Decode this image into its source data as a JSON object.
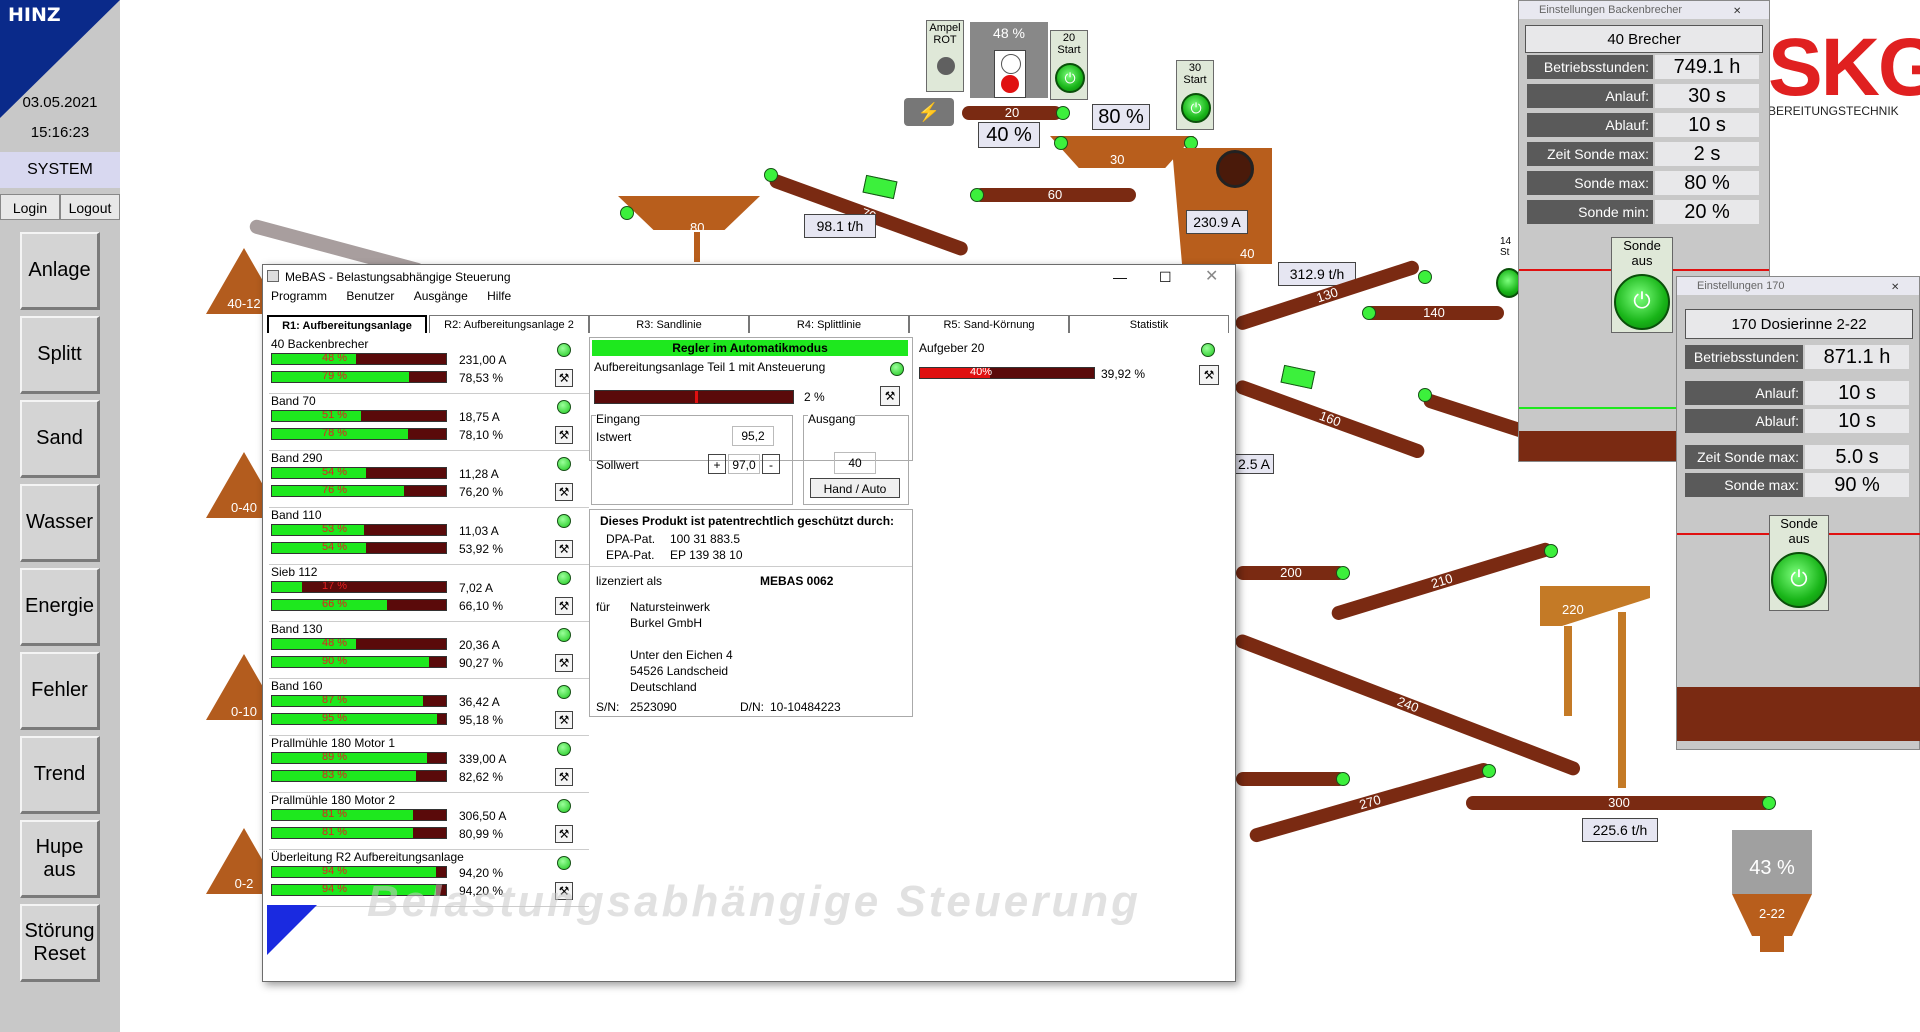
{
  "left": {
    "brand": "HINZ",
    "date": "03.05.2021",
    "time": "15:16:23",
    "system": "SYSTEM",
    "login": "Login",
    "logout": "Logout",
    "nav": [
      "Anlage",
      "Splitt",
      "Sand",
      "Wasser",
      "Energie",
      "Fehler",
      "Trend",
      "Hupe aus",
      "Störung Reset"
    ]
  },
  "plant": {
    "ampel": "Ampel ROT",
    "silo_pct": "48 %",
    "start20": "20 Start",
    "start30": "30 Start",
    "c20": "20",
    "pct40": "40 %",
    "pct80": "80 %",
    "c30": "30",
    "c70": "70",
    "c80": "80",
    "c60": "60",
    "flow70": "98.1 t/h",
    "amp40": "230.9 A",
    "c40": "40",
    "flow130": "312.9 t/h",
    "c130": "130",
    "c140": "140",
    "c160": "160",
    "amp_partial": "2.5 A",
    "c200": "200",
    "c210": "210",
    "c220": "220",
    "c240": "240",
    "c270": "270",
    "c300": "300",
    "flow300": "225.6 t/h",
    "silo2_pct": "43 %",
    "silo2_label": "2-22",
    "pile1": "40-12",
    "pile2": "0-40",
    "pile3": "0-10",
    "pile4": "0-2",
    "skg": "SKG",
    "skg_sub": "BEREITUNGSTECHNIK",
    "partial_st": "14 St"
  },
  "mebas": {
    "title": "MeBAS - Belastungsabhängige Steuerung",
    "menu": [
      "Programm",
      "Benutzer",
      "Ausgänge",
      "Hilfe"
    ],
    "tabs": [
      "R1: Aufbereitungsanlage",
      "R2: Aufbereitungsanlage 2",
      "R3: Sandlinie",
      "R4: Splittlinie",
      "R5: Sand-Körnung",
      "Statistik"
    ],
    "rows": [
      {
        "name": "40 Backenbrecher",
        "p1": "48 %",
        "f1": 48,
        "v1": "231,00 A",
        "p2": "79 %",
        "f2": 79,
        "v2": "78,53 %"
      },
      {
        "name": "Band 70",
        "p1": "51 %",
        "f1": 51,
        "v1": "18,75 A",
        "p2": "78 %",
        "f2": 78,
        "v2": "78,10 %"
      },
      {
        "name": "Band 290",
        "p1": "54 %",
        "f1": 54,
        "v1": "11,28 A",
        "p2": "76 %",
        "f2": 76,
        "v2": "76,20 %"
      },
      {
        "name": "Band 110",
        "p1": "53 %",
        "f1": 53,
        "v1": "11,03 A",
        "p2": "54 %",
        "f2": 54,
        "v2": "53,92 %"
      },
      {
        "name": "Sieb 112",
        "p1": "17 %",
        "f1": 17,
        "v1": "7,02 A",
        "p2": "66 %",
        "f2": 66,
        "v2": "66,10 %"
      },
      {
        "name": "Band 130",
        "p1": "48 %",
        "f1": 48,
        "v1": "20,36 A",
        "p2": "90 %",
        "f2": 90,
        "v2": "90,27 %"
      },
      {
        "name": "Band 160",
        "p1": "87 %",
        "f1": 87,
        "v1": "36,42 A",
        "p2": "95 %",
        "f2": 95,
        "v2": "95,18 %"
      },
      {
        "name": "Prallmühle 180 Motor 1",
        "p1": "89 %",
        "f1": 89,
        "v1": "339,00 A",
        "p2": "83 %",
        "f2": 83,
        "v2": "82,62 %"
      },
      {
        "name": "Prallmühle 180 Motor 2",
        "p1": "81 %",
        "f1": 81,
        "v1": "306,50 A",
        "p2": "81 %",
        "f2": 81,
        "v2": "80,99 %"
      },
      {
        "name": "Überleitung R2 Aufbereitungsanlage",
        "p1": "94 %",
        "f1": 94,
        "v1": "94,20 %",
        "p2": "94 %",
        "f2": 94,
        "v2": "94,20 %"
      }
    ],
    "regler": "Regler im Automatikmodus",
    "anlage": "Aufbereitungsanlage Teil 1 mit Ansteuerung",
    "regler_pct": "2 %",
    "eingang": "Eingang",
    "istwert_l": "Istwert",
    "istwert": "95,2",
    "sollwert_l": "Sollwert",
    "sollwert": "97,0",
    "plus": "+",
    "minus": "-",
    "ausgang": "Ausgang",
    "ausgang_v": "40",
    "handauto": "Hand / Auto",
    "patent_h": "Dieses Produkt ist patentrechtlich geschützt durch:",
    "dpa_l": "DPA-Pat.",
    "dpa": "100 31 883.5",
    "epa_l": "EPA-Pat.",
    "epa": "EP 139 38 10",
    "lizenz_l": "lizenziert als",
    "lizenz": "MEBAS 0062",
    "fuer": "für",
    "addr": [
      "Natursteinwerk",
      "Burkel GmbH",
      "",
      "Unter den Eichen 4",
      "54526 Landscheid",
      "Deutschland"
    ],
    "sn_l": "S/N:",
    "sn": "2523090",
    "dn_l": "D/N:",
    "dn": "10-10484223",
    "aufgeber": "Aufgeber 20",
    "aufgeber_p": "40%",
    "aufgeber_f": 40,
    "aufgeber_v": "39,92 %",
    "watermark": "Belastungsabhängige Steuerung"
  },
  "panel1": {
    "title": "Einstellungen Backenbrecher",
    "name": "40 Brecher",
    "rows": [
      {
        "l": "Betriebsstunden:",
        "v": "749.1 h"
      },
      {
        "l": "Anlauf:",
        "v": "30 s"
      },
      {
        "l": "Ablauf:",
        "v": "10 s"
      },
      {
        "l": "Zeit Sonde max:",
        "v": "2 s"
      },
      {
        "l": "Sonde max:",
        "v": "80 %"
      },
      {
        "l": "Sonde min:",
        "v": "20 %"
      }
    ],
    "sonde": "Sonde aus"
  },
  "panel2": {
    "title": "Einstellungen 170",
    "name": "170 Dosierinne 2-22",
    "rows": [
      {
        "l": "Betriebsstunden:",
        "v": "871.1 h"
      },
      {
        "l": "Anlauf:",
        "v": "10 s"
      },
      {
        "l": "Ablauf:",
        "v": "10 s"
      },
      {
        "l": "Zeit Sonde max:",
        "v": "5.0 s"
      },
      {
        "l": "Sonde max:",
        "v": "90 %"
      }
    ],
    "sonde": "Sonde aus"
  },
  "colors": {
    "accent": "#0a2a8a",
    "conveyor": "#7a2a12",
    "green": "#1ee81e",
    "skg": "#e02020"
  }
}
